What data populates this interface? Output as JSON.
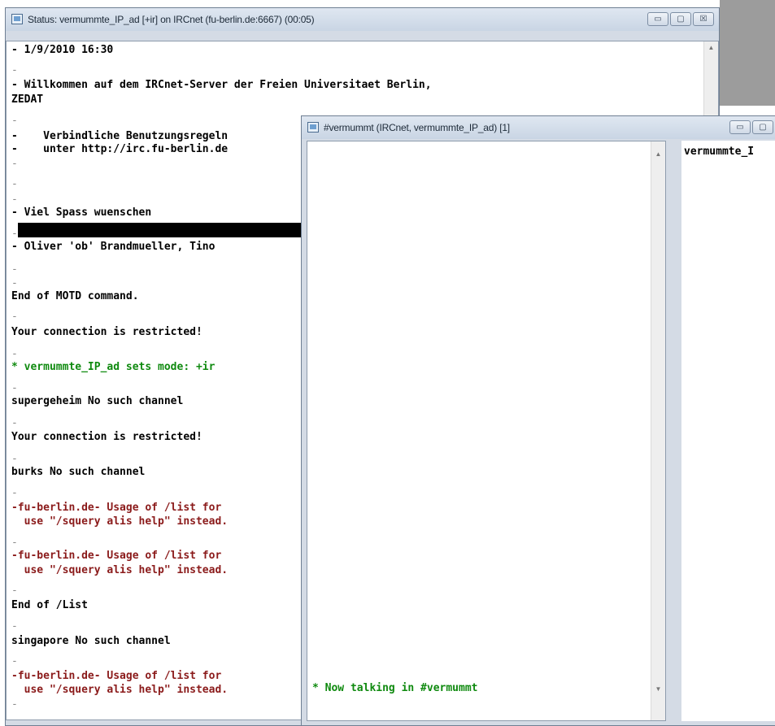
{
  "status_window": {
    "title": "Status: vermummte_IP_ad [+ir] on IRCnet (fu-berlin.de:6667) (00:05)",
    "controls": {
      "minimize": "▭",
      "maximize": "▢",
      "close": "☒"
    },
    "lines": [
      "- 1/9/2010 16:30",
      "-",
      "- Willkommen auf dem IRCnet-Server der Freien Universitaet Berlin,",
      "ZEDAT",
      "-",
      "-    Verbindliche Benutzungsregeln",
      "-    unter http://irc.fu-berlin.de",
      "-",
      "-",
      "-",
      "- Viel Spass wuenschen",
      "-",
      "- Oliver 'ob' Brandmueller, Tino",
      "-",
      "-",
      "End of MOTD command.",
      "-",
      "Your connection is restricted!",
      "-",
      "* vermummte_IP_ad sets mode: +ir",
      "-",
      "supergeheim No such channel",
      "-",
      "Your connection is restricted!",
      "-",
      "burks No such channel",
      "-",
      "-fu-berlin.de- Usage of /list for",
      "  use \"/squery alis help\" instead.",
      "-",
      "-fu-berlin.de- Usage of /list for",
      "  use \"/squery alis help\" instead.",
      "-",
      "End of /List",
      "-",
      "singapore No such channel",
      "-",
      "-fu-berlin.de- Usage of /list for",
      "  use \"/squery alis help\" instead.",
      "-"
    ]
  },
  "channel_window": {
    "title": "#vermummt (IRCnet, vermummte_IP_ad) [1]",
    "controls": {
      "minimize": "▭",
      "maximize": "▢",
      "close": "☒"
    },
    "message": "* Now talking in #vermummt",
    "nick": "vermummte_I"
  },
  "colors": {
    "system": "#0f8a0f",
    "server_notice": "#8b1b1b",
    "desktop": "#9c9c9c"
  }
}
